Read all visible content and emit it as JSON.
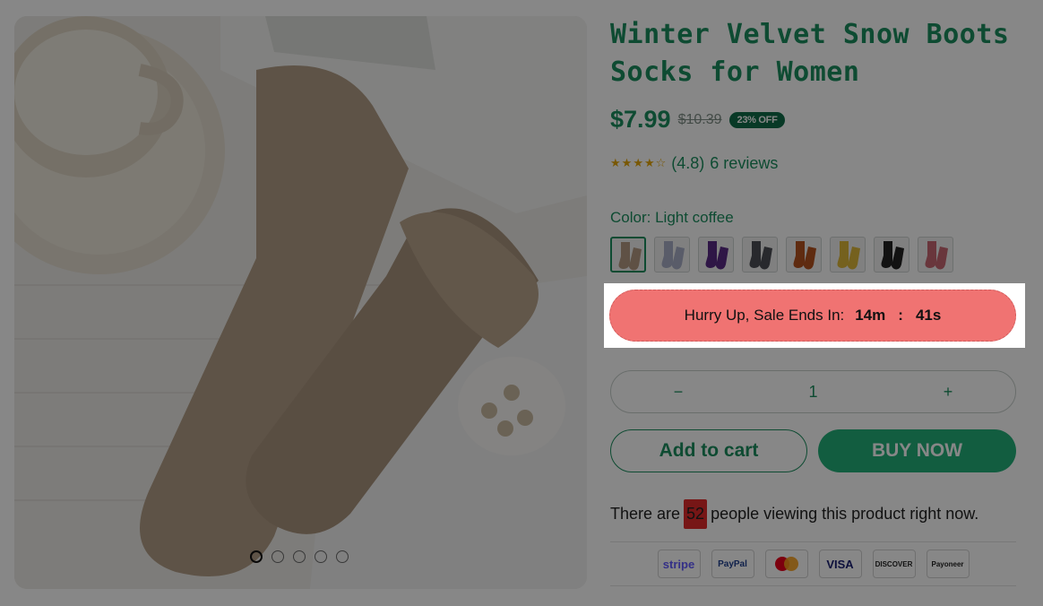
{
  "product": {
    "title_line1": "Winter Velvet Snow Boots",
    "title_line2": "Socks for Women",
    "price": "$7.99",
    "compare_price": "$10.39",
    "discount_badge": "23% OFF",
    "rating": "(4.8)",
    "reviews": "6 reviews",
    "star_icon": "star-icon"
  },
  "color": {
    "label": "Color:",
    "selected": "Light coffee",
    "options": [
      {
        "name": "light-coffee",
        "hex": "#b39a82"
      },
      {
        "name": "gray-blue",
        "hex": "#a9afc7"
      },
      {
        "name": "purple",
        "hex": "#5a2a85"
      },
      {
        "name": "dark-gray",
        "hex": "#4c4f55"
      },
      {
        "name": "rust",
        "hex": "#b4511f"
      },
      {
        "name": "mustard",
        "hex": "#ddb83a"
      },
      {
        "name": "black",
        "hex": "#222222"
      },
      {
        "name": "rose",
        "hex": "#c76671"
      }
    ]
  },
  "gallery": {
    "dots_total": 5,
    "active_index": 0
  },
  "countdown": {
    "label": "Hurry Up, Sale Ends In:",
    "minutes": "14m",
    "separator": ":",
    "seconds": "41s"
  },
  "quantity": {
    "minus": "−",
    "value": "1",
    "plus": "+"
  },
  "buttons": {
    "add_to_cart": "Add to cart",
    "buy_now": "BUY NOW"
  },
  "viewing": {
    "prefix": "There are",
    "count": "52",
    "suffix": "people viewing this product right now."
  },
  "payments": [
    {
      "name": "stripe",
      "label": "stripe",
      "color": "#635bff"
    },
    {
      "name": "paypal",
      "label": "PayPal",
      "color": "#1f3f8f"
    },
    {
      "name": "mastercard",
      "label": "",
      "color": "#eb001b"
    },
    {
      "name": "visa",
      "label": "VISA",
      "color": "#1a1f71"
    },
    {
      "name": "discover",
      "label": "DISCOVER",
      "color": "#222222"
    },
    {
      "name": "payoneer",
      "label": "Payoneer",
      "color": "#222222"
    }
  ],
  "colors": {
    "brand_green": "#1c8f5f",
    "buy_button": "#22b07a",
    "countdown_bg": "#f07372",
    "overlay": "rgba(0,0,0,0.47)"
  }
}
